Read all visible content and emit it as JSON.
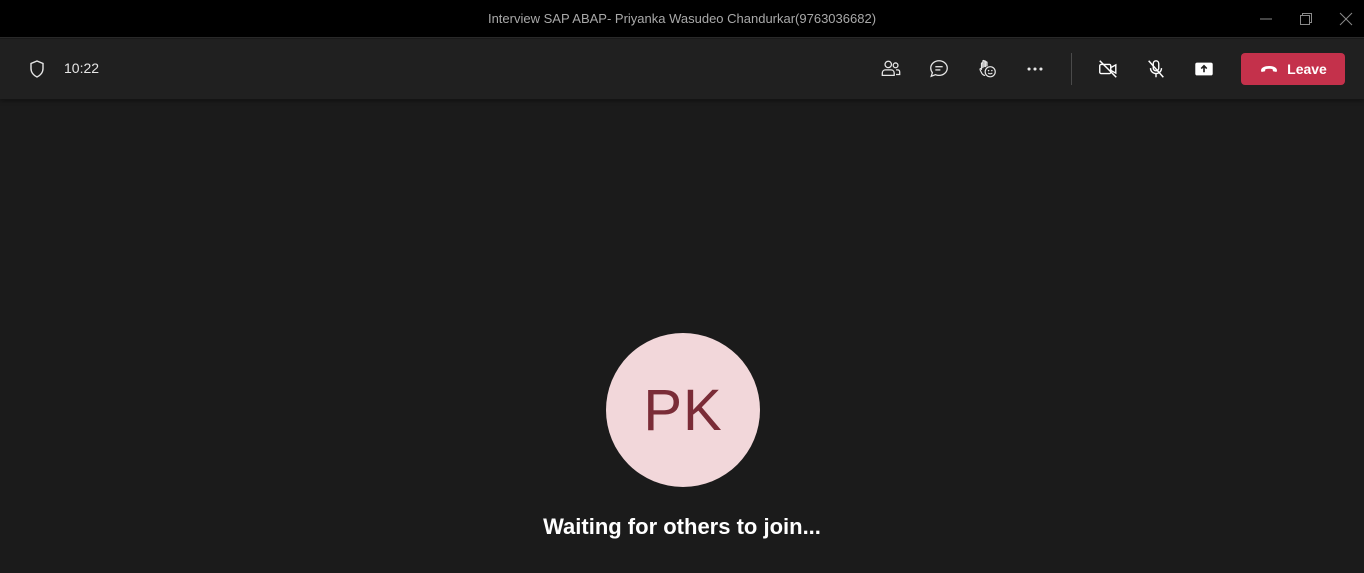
{
  "window": {
    "title": "Interview SAP ABAP- Priyanka Wasudeo Chandurkar(9763036682)",
    "controls": [
      "minimize-icon",
      "restore-icon",
      "close-icon"
    ]
  },
  "toolbar": {
    "timer": "10:22",
    "buttons": [
      "people-icon",
      "chat-icon",
      "reactions-icon",
      "more-options-icon",
      "camera-off-icon",
      "mic-off-icon",
      "share-screen-icon"
    ],
    "leave_label": "Leave",
    "leave_color": "#c4314b"
  },
  "stage": {
    "avatar_initials": "PK",
    "avatar_bg": "#f2d7da",
    "avatar_fg": "#7a2c37",
    "status": "Waiting for others to join..."
  }
}
